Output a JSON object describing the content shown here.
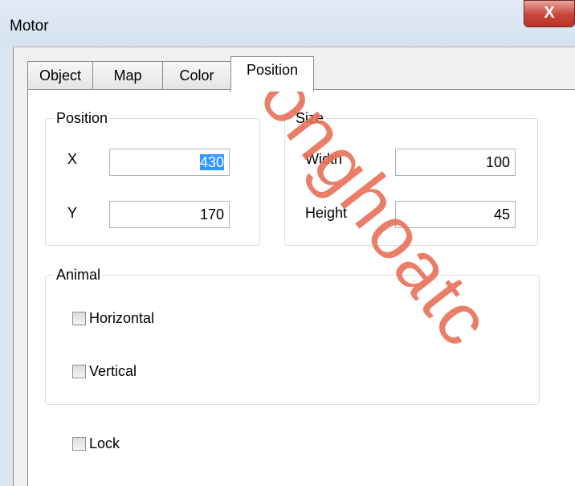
{
  "window": {
    "title": "Motor",
    "close_label": "X"
  },
  "tabs": [
    {
      "label": "Object",
      "active": false
    },
    {
      "label": "Map",
      "active": false
    },
    {
      "label": "Color",
      "active": false
    },
    {
      "label": "Position",
      "active": true
    }
  ],
  "position_group": {
    "label": "Position",
    "x_label": "X",
    "x_value": "430",
    "y_label": "Y",
    "y_value": "170"
  },
  "size_group": {
    "label": "Size",
    "width_label": "Width",
    "width_value": "100",
    "height_label": "Height",
    "height_value": "45"
  },
  "animal_group": {
    "label": "Animal",
    "horizontal_label": "Horizontal",
    "horizontal_checked": false,
    "vertical_label": "Vertical",
    "vertical_checked": false
  },
  "lock": {
    "label": "Lock",
    "checked": false
  },
  "watermark": {
    "text": "onghoatc",
    "color": "#e87058"
  }
}
